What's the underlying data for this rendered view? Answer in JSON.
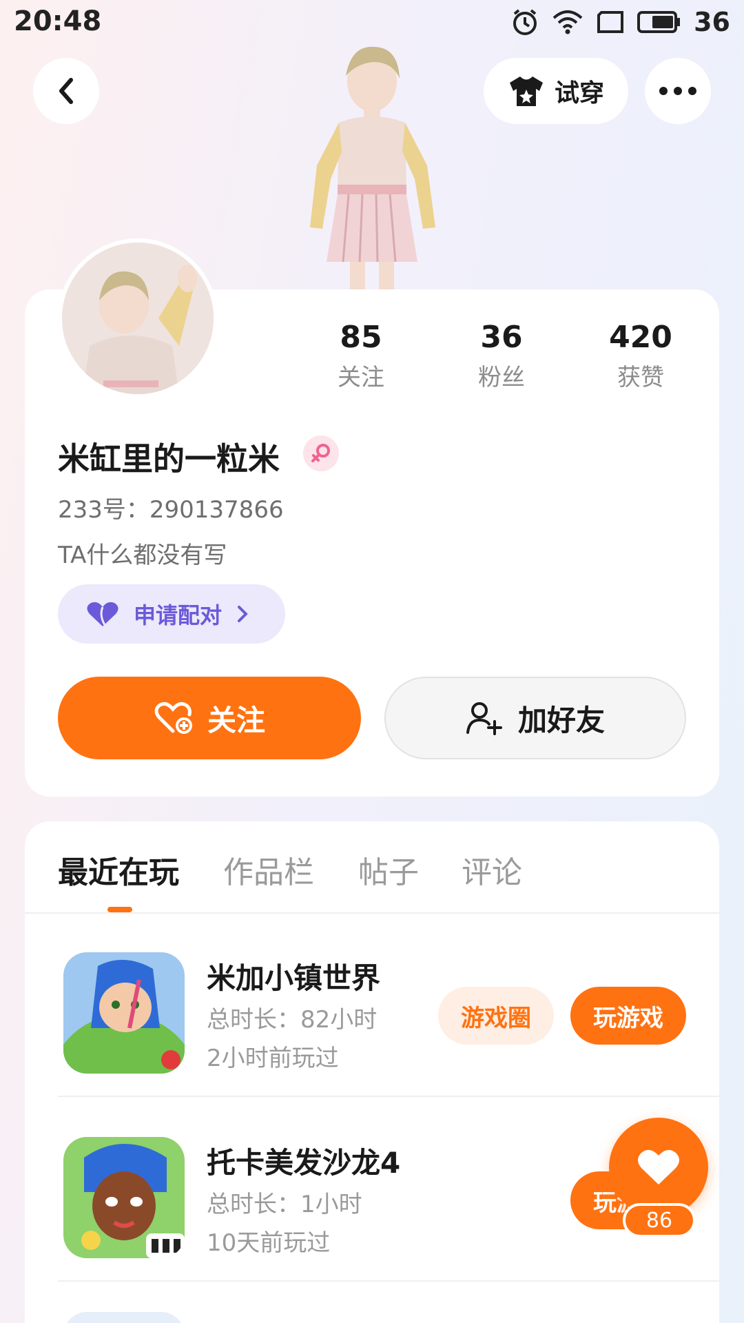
{
  "status_bar": {
    "time": "20:48",
    "battery": "36"
  },
  "header": {
    "try_on_label": "试穿"
  },
  "profile": {
    "stats": [
      {
        "value": "85",
        "label": "关注"
      },
      {
        "value": "36",
        "label": "粉丝"
      },
      {
        "value": "420",
        "label": "获赞"
      }
    ],
    "username": "米缸里的一粒米",
    "user_id": "233号：290137866",
    "bio": "TA什么都没有写",
    "pair_label": "申请配对",
    "follow_label": "关注",
    "add_friend_label": "加好友"
  },
  "tabs": [
    "最近在玩",
    "作品栏",
    "帖子",
    "评论"
  ],
  "games": [
    {
      "name": "米加小镇世界",
      "duration": "总时长：82小时",
      "last_played": "2小时前玩过",
      "circle_label": "游戏圈",
      "play_label": "玩游戏"
    },
    {
      "name": "托卡美发沙龙4",
      "duration": "总时长：1小时",
      "last_played": "10天前玩过",
      "play_label": "玩游戏"
    }
  ],
  "like_count": "86",
  "colors": {
    "accent": "#ff7211",
    "pair_purple": "#6a5ad9",
    "female_pink": "#f06292"
  }
}
